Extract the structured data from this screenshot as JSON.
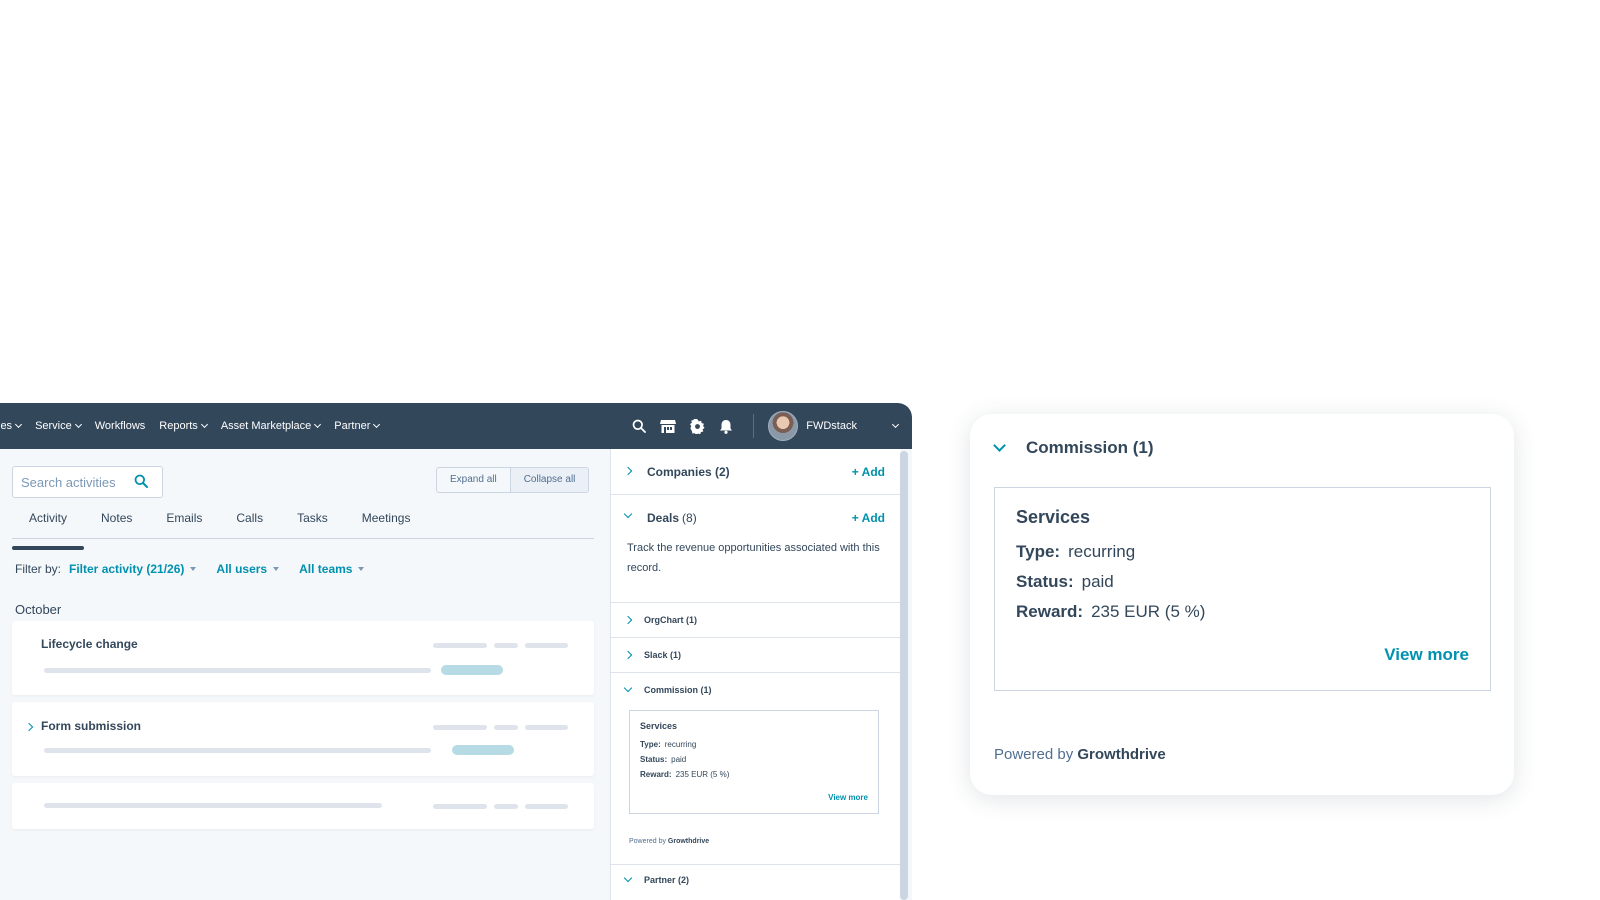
{
  "nav": {
    "items": [
      {
        "label": "les",
        "caret": true
      },
      {
        "label": "Service",
        "caret": true
      },
      {
        "label": "Workflows",
        "caret": false
      },
      {
        "label": "Reports",
        "caret": true
      },
      {
        "label": "Asset Marketplace",
        "caret": true
      },
      {
        "label": "Partner",
        "caret": true
      }
    ],
    "icons": [
      "search-icon",
      "marketplace-icon",
      "settings-icon",
      "notifications-icon"
    ],
    "user": {
      "name": "FWDstack"
    }
  },
  "activity": {
    "search_placeholder": "Search activities",
    "expand_all": "Expand all",
    "collapse_all": "Collapse all",
    "tabs": [
      "Activity",
      "Notes",
      "Emails",
      "Calls",
      "Tasks",
      "Meetings"
    ],
    "active_tab": "Activity",
    "filter_label": "Filter by:",
    "filter_activity": "Filter activity (21/26)",
    "filter_users": "All users",
    "filter_teams": "All teams",
    "month": "October",
    "cards": [
      {
        "title": "Lifecycle change"
      },
      {
        "title": "Form submission"
      }
    ]
  },
  "sidebar": {
    "companies": {
      "title": "Companies (2)",
      "add": "+ Add"
    },
    "deals": {
      "title": "Deals",
      "count": "(8)",
      "add": "+ Add",
      "description": "Track the revenue opportunities associated with this record."
    },
    "orgchart": {
      "title": "OrgChart (1)"
    },
    "slack": {
      "title": "Slack (1)"
    },
    "commission": {
      "title": "Commission (1)"
    },
    "partner": {
      "title": "Partner (2)"
    }
  },
  "commission": {
    "title": "Commission (1)",
    "card_title": "Services",
    "type_label": "Type:",
    "type_value": "recurring",
    "status_label": "Status:",
    "status_value": "paid",
    "reward_label": "Reward:",
    "reward_value": "235 EUR (5 %)",
    "view_more": "View more",
    "powered_prefix": "Powered by",
    "powered_brand": "Growthdrive"
  },
  "colors": {
    "topbar": "#33475b",
    "accent": "#0091ae",
    "background": "#f5f8fa"
  }
}
